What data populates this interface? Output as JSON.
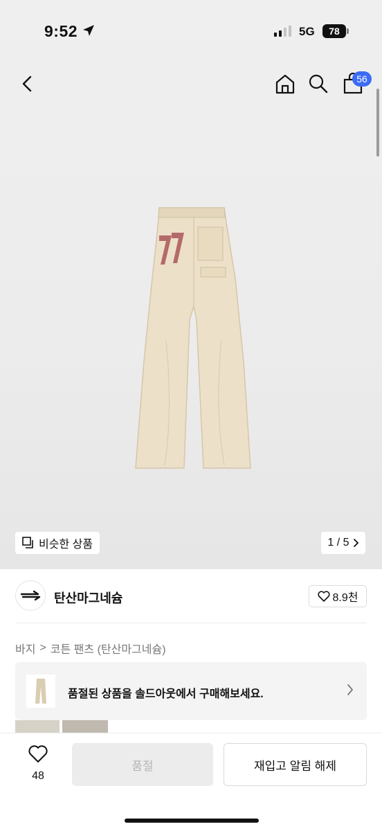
{
  "status_bar": {
    "time": "9:52",
    "network": "5G",
    "battery": "78"
  },
  "nav": {
    "cart_count": "56"
  },
  "gallery": {
    "similar_label": "비슷한 상품",
    "page_indicator": "1 / 5"
  },
  "brand": {
    "name": "탄산마그네슘",
    "likes": "8.9천"
  },
  "breadcrumb": {
    "category": "바지",
    "separator": ">",
    "product": "코튼 팬츠 (탄산마그네슘)"
  },
  "soldout_banner": {
    "text": "품절된 상품을 솔드아웃에서 구매해보세요."
  },
  "bottom_bar": {
    "wish_count": "48",
    "soldout_label": "품절",
    "restock_label": "재입고 알림 해제"
  },
  "colors": {
    "badge": "#3b6cf6",
    "pants": "#ece0c8",
    "patch": "#b46a6a"
  }
}
